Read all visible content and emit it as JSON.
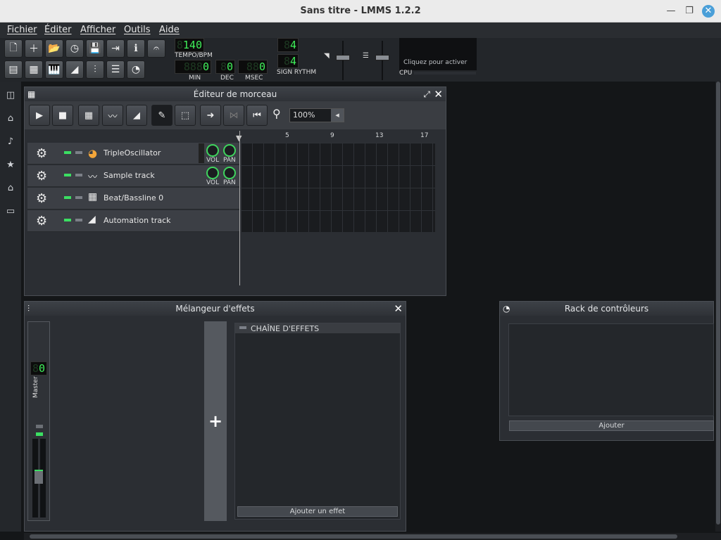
{
  "window": {
    "title": "Sans titre - LMMS 1.2.2"
  },
  "menu": [
    "Fichier",
    "Éditer",
    "Afficher",
    "Outils",
    "Aide"
  ],
  "transport": {
    "tempo": "140",
    "tempo_label": "TEMPO/BPM",
    "min": "0",
    "min_label": "MIN",
    "dec": "0",
    "dec_label": "DEC",
    "msec": "0",
    "msec_label": "MSEC",
    "sign_num": "4",
    "sign_den": "4",
    "sign_label": "SIGN RYTHM",
    "cpu_hint": "Cliquez pour activer",
    "cpu_label": "CPU"
  },
  "song_editor": {
    "title": "Éditeur de morceau",
    "zoom": "100%",
    "bars": [
      "5",
      "9",
      "13",
      "17"
    ],
    "tracks": [
      {
        "name": "TripleOscillator",
        "knobs": true
      },
      {
        "name": "Sample track",
        "knobs": true
      },
      {
        "name": "Beat/Bassline 0",
        "knobs": false
      },
      {
        "name": "Automation track",
        "knobs": false
      }
    ],
    "vol": "VOL",
    "pan": "PAN"
  },
  "mixer": {
    "title": "Mélangeur d'effets",
    "channel": "Master",
    "channel_num": "0",
    "chain_label": "CHAÎNE D'EFFETS",
    "add_effect": "Ajouter un effet",
    "add_channel": "+"
  },
  "controller_rack": {
    "title": "Rack de contrôleurs",
    "add": "Ajouter"
  }
}
